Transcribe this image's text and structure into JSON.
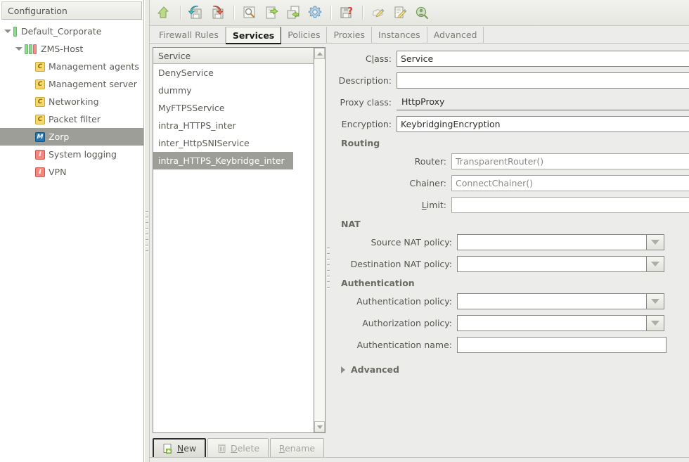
{
  "tree": {
    "header": "Configuration",
    "items": [
      {
        "label": "Default_Corporate",
        "icon": "bars-green-icon",
        "depth": 0,
        "expander": "open",
        "selected": false
      },
      {
        "label": "ZMS-Host",
        "icon": "bars-green-green-red-icon",
        "depth": 1,
        "expander": "open",
        "selected": false
      },
      {
        "label": "Management agents",
        "icon": "component-c-icon",
        "depth": 2,
        "expander": "none",
        "selected": false
      },
      {
        "label": "Management server",
        "icon": "component-c-icon",
        "depth": 2,
        "expander": "none",
        "selected": false
      },
      {
        "label": "Networking",
        "icon": "component-c-icon",
        "depth": 2,
        "expander": "none",
        "selected": false
      },
      {
        "label": "Packet filter",
        "icon": "component-c-icon",
        "depth": 2,
        "expander": "none",
        "selected": false
      },
      {
        "label": "Zorp",
        "icon": "module-m-icon",
        "depth": 2,
        "expander": "none",
        "selected": true
      },
      {
        "label": "System logging",
        "icon": "instance-i-icon",
        "depth": 2,
        "expander": "none",
        "selected": false
      },
      {
        "label": "VPN",
        "icon": "instance-i-icon",
        "depth": 2,
        "expander": "none",
        "selected": false
      }
    ]
  },
  "toolbar": {
    "buttons": [
      {
        "name": "upload-icon"
      },
      {
        "name": "separator"
      },
      {
        "name": "save-import-icon"
      },
      {
        "name": "save-export-icon"
      },
      {
        "name": "separator"
      },
      {
        "name": "search-icon"
      },
      {
        "name": "document-in-icon"
      },
      {
        "name": "document-out-icon"
      },
      {
        "name": "settings-gear-icon"
      },
      {
        "name": "separator"
      },
      {
        "name": "save-help-icon"
      },
      {
        "name": "separator"
      },
      {
        "name": "cloud-edit-icon"
      },
      {
        "name": "document-edit-icon"
      },
      {
        "name": "search-user-icon"
      }
    ]
  },
  "tabs": [
    {
      "label": "Firewall Rules",
      "active": false
    },
    {
      "label": "Services",
      "active": true
    },
    {
      "label": "Policies",
      "active": false
    },
    {
      "label": "Proxies",
      "active": false
    },
    {
      "label": "Instances",
      "active": false
    },
    {
      "label": "Advanced",
      "active": false
    }
  ],
  "service_list": {
    "column_header": "Service",
    "items": [
      {
        "label": "DenyService",
        "selected": false
      },
      {
        "label": "dummy",
        "selected": false
      },
      {
        "label": "MyFTPSService",
        "selected": false
      },
      {
        "label": "intra_HTTPS_inter",
        "selected": false
      },
      {
        "label": "inter_HttpSNIService",
        "selected": false
      },
      {
        "label": "intra_HTTPS_Keybridge_inter",
        "selected": true
      }
    ],
    "buttons": [
      {
        "name": "new-button",
        "label_pre": "",
        "label_mnemonic": "N",
        "label_post": "ew",
        "icon": "new-document-plus-icon",
        "state": "focused"
      },
      {
        "name": "delete-button",
        "label_pre": "",
        "label_mnemonic": "D",
        "label_post": "elete",
        "icon": "trash-icon",
        "state": "disabled"
      },
      {
        "name": "rename-button",
        "label_pre": "",
        "label_mnemonic": "R",
        "label_post": "ename",
        "icon": "",
        "state": "disabled"
      }
    ]
  },
  "form": {
    "class": {
      "label_pre": "C",
      "label_mnemonic": "l",
      "label_post": "ass:",
      "value": "Service",
      "control": "combobox"
    },
    "description": {
      "label": "Description:",
      "value": "",
      "placeholder": "",
      "control": "text-with-browse"
    },
    "proxy_class": {
      "label": "Proxy class:",
      "value": "HttpProxy",
      "control": "combobox-flat"
    },
    "encryption": {
      "label": "Encryption:",
      "value": "KeybridgingEncryption",
      "control": "combobox-focused"
    },
    "routing": {
      "title": "Routing",
      "router": {
        "label": "Router:",
        "value": "TransparentRouter()"
      },
      "chainer": {
        "label": "Chainer:",
        "value": "ConnectChainer()"
      },
      "limit": {
        "label_pre": "",
        "label_mnemonic": "L",
        "label_post": "imit:",
        "value": ""
      }
    },
    "nat": {
      "title": "NAT",
      "source": {
        "label": "Source NAT policy:",
        "value": ""
      },
      "destination": {
        "label": "Destination NAT policy:",
        "value": ""
      }
    },
    "authentication": {
      "title": "Authentication",
      "auth_policy": {
        "label": "Authentication policy:",
        "value": ""
      },
      "authz_policy": {
        "label": "Authorization policy:",
        "value": ""
      },
      "auth_name": {
        "label": "Authentication name:",
        "value": ""
      }
    },
    "advanced": {
      "label": "Advanced",
      "expanded": false
    }
  },
  "colors": {
    "window_bg": "#ececeA",
    "selection": "#9e9e98",
    "text": "#55554f",
    "accent_green": "#8ade8a",
    "accent_red": "#f4867e",
    "module_blue": "#2277b8"
  }
}
